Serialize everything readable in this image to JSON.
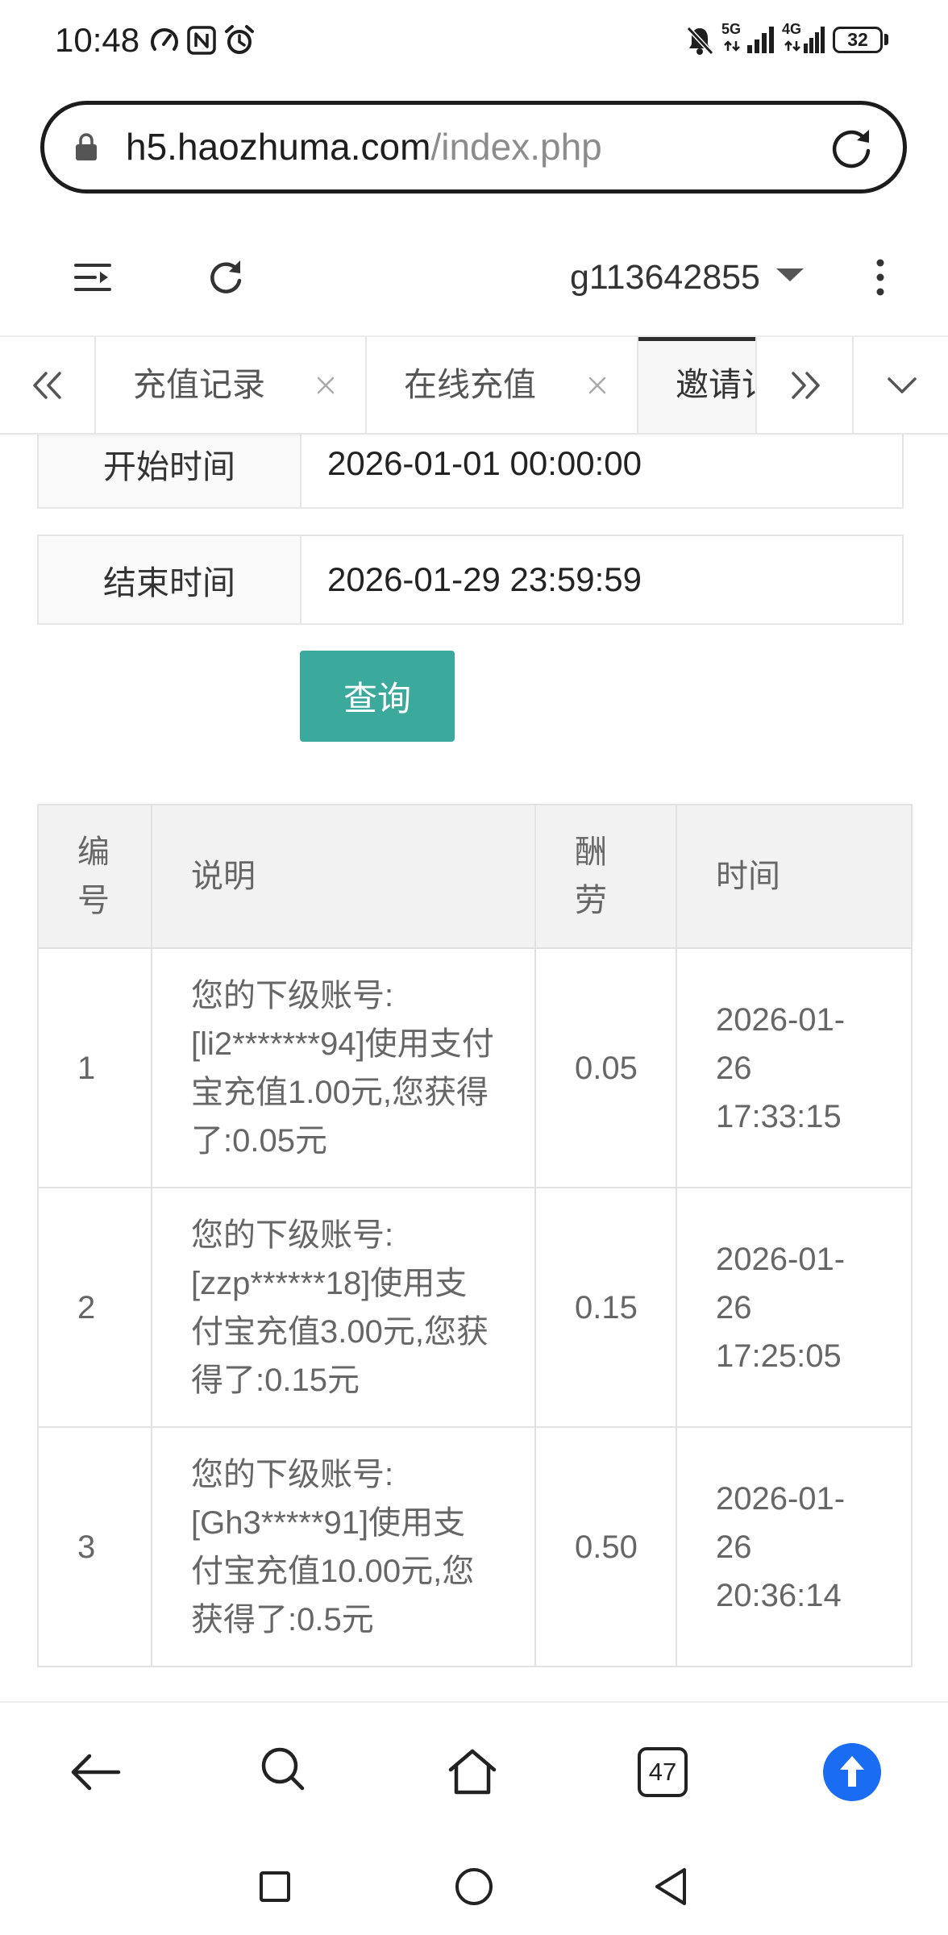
{
  "status_bar": {
    "time": "10:48",
    "network_1": "5G",
    "network_2": "4G",
    "battery_level": "32",
    "icons": [
      "speedometer-icon",
      "nfc-icon",
      "alarm-icon",
      "mute-bell-icon",
      "signal-icon",
      "battery-icon"
    ]
  },
  "browser": {
    "url_host": "h5.haozhuma.com",
    "url_path": "/index.php",
    "open_tabs": "47"
  },
  "header": {
    "username": "g113642855"
  },
  "tabs": {
    "items": [
      {
        "label": "充值记录",
        "closable": true,
        "active": false
      },
      {
        "label": "在线充值",
        "closable": true,
        "active": false
      },
      {
        "label": "邀请记",
        "closable": false,
        "active": true
      }
    ]
  },
  "filter": {
    "start_label": "开始时间",
    "start_value": "2026-01-01 00:00:00",
    "end_label": "结束时间",
    "end_value": "2026-01-29 23:59:59",
    "query_button": "查询"
  },
  "table": {
    "headers": {
      "id": "编号",
      "desc": "说明",
      "reward": "酬劳",
      "time": "时间"
    },
    "rows": [
      {
        "id": "1",
        "desc": "您的下级账号:[li2*******94]使用支付宝充值1.00元,您获得了:0.05元",
        "reward": "0.05",
        "time": "2026-01-26 17:33:15"
      },
      {
        "id": "2",
        "desc": "您的下级账号:[zzp******18]使用支付宝充值3.00元,您获得了:0.15元",
        "reward": "0.15",
        "time": "2026-01-26 17:25:05"
      },
      {
        "id": "3",
        "desc": "您的下级账号:[Gh3*****91]使用支付宝充值10.00元,您获得了:0.5元",
        "reward": "0.50",
        "time": "2026-01-26 20:36:14"
      }
    ]
  },
  "colors": {
    "query_button": "#3ba99c",
    "scroll_top_button": "#1a6df2",
    "active_tab_indicator": "#2f2f2f"
  }
}
